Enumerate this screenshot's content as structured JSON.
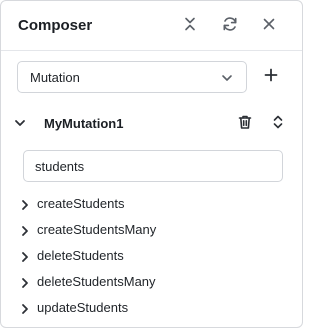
{
  "header": {
    "title": "Composer",
    "icons": [
      "collapse-icon",
      "refresh-icon",
      "close-icon"
    ]
  },
  "operation_type": {
    "selected": "Mutation",
    "add_icon": "plus-icon"
  },
  "operation": {
    "name": "MyMutation1",
    "icons": [
      "trash-icon",
      "expand-collapse-icon"
    ]
  },
  "search": {
    "value": "students"
  },
  "fields": [
    {
      "label": "createStudents"
    },
    {
      "label": "createStudentsMany"
    },
    {
      "label": "deleteStudents"
    },
    {
      "label": "deleteStudentsMany"
    },
    {
      "label": "updateStudents"
    }
  ]
}
